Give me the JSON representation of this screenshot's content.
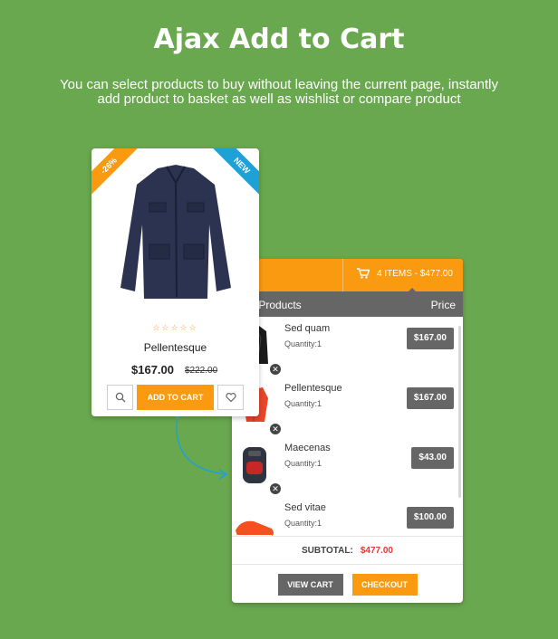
{
  "header": {
    "title": "Ajax Add to Cart",
    "subtitle_line1": "You can select products to buy without leaving the current page, instantly",
    "subtitle_line2": "add product to basket as well as wishlist or compare product"
  },
  "product_card": {
    "sale_badge": "-26%",
    "new_badge": "NEW",
    "rating_stars": "☆☆☆☆☆",
    "name": "Pellentesque",
    "price": "$167.00",
    "old_price": "$222.00",
    "add_to_cart_label": "ADD TO CART",
    "accent_color": "#f99a10"
  },
  "cart": {
    "summary": "4 ITEMS - $477.00",
    "col_products": "r Products",
    "col_price": "Price",
    "items": [
      {
        "name": "Sed quam",
        "qty": "Quantity:1",
        "price": "$167.00"
      },
      {
        "name": "Pellentesque",
        "qty": "Quantity:1",
        "price": "$167.00"
      },
      {
        "name": "Maecenas",
        "qty": "Quantity:1",
        "price": "$43.00"
      },
      {
        "name": "Sed vitae",
        "qty": "Quantity:1",
        "price": "$100.00"
      }
    ],
    "subtotal_label": "SUBTOTAL:",
    "subtotal_value": "$477.00",
    "view_cart_label": "VIEW CART",
    "checkout_label": "CHECKOUT"
  }
}
